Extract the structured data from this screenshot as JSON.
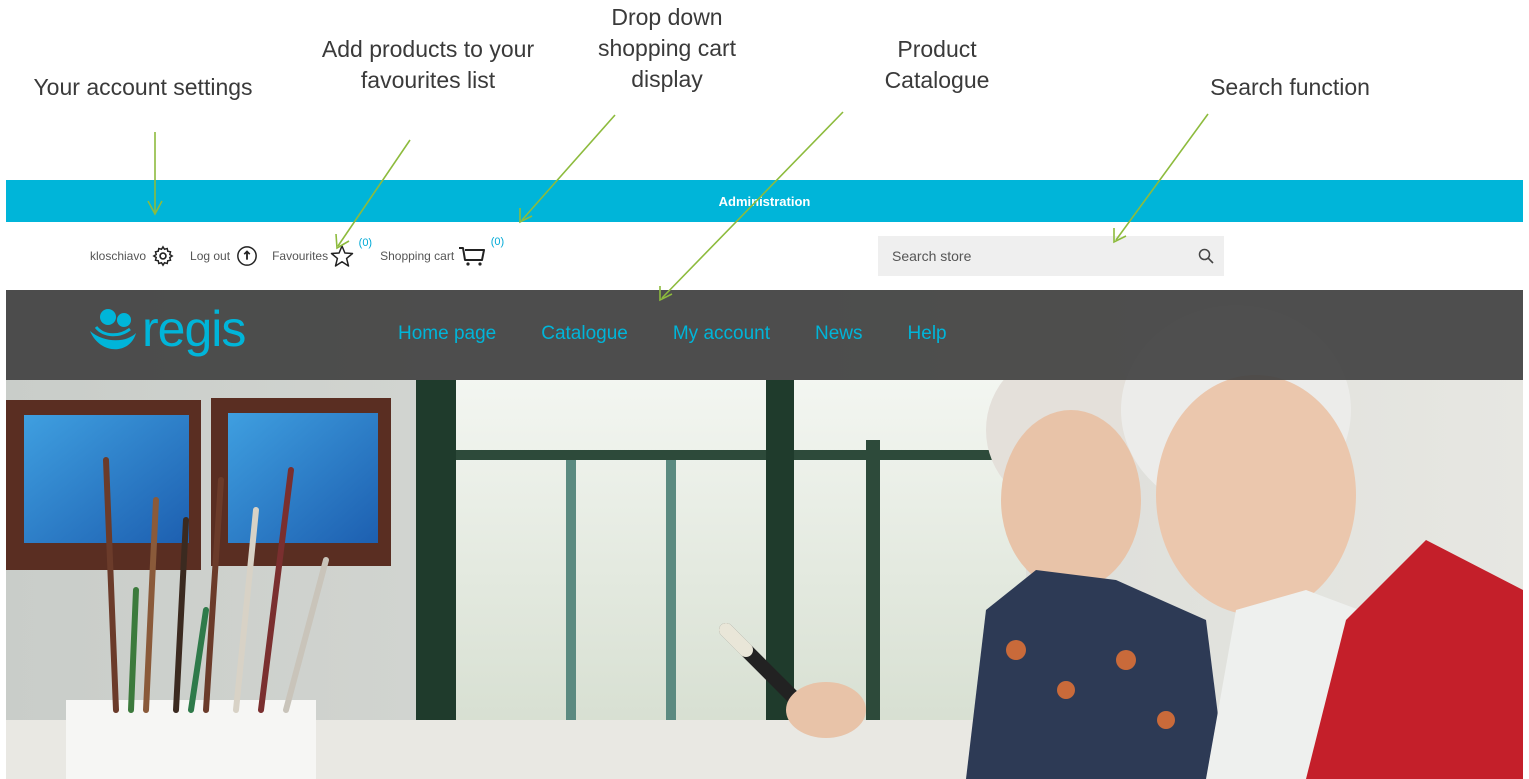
{
  "annotations": {
    "account": "Your account settings",
    "favourites": "Add products to your favourites list",
    "cart": "Drop down shopping cart display",
    "catalogue": "Product Catalogue",
    "search": "Search function",
    "arrow_color": "#8dbb3d"
  },
  "admin_bar": {
    "label": "Administration",
    "color": "#00b5d9"
  },
  "utility": {
    "username": "kloschiavo",
    "settings_icon": "gear-icon",
    "logout_label": "Log out",
    "logout_icon": "logout-icon",
    "favourites_label": "Favourites",
    "favourites_icon": "star-icon",
    "favourites_count": "(0)",
    "cart_label": "Shopping cart",
    "cart_icon": "cart-icon",
    "cart_count": "(0)"
  },
  "search": {
    "placeholder": "Search store",
    "icon": "search-icon"
  },
  "logo": {
    "text": "regis"
  },
  "nav": {
    "home": "Home page",
    "catalogue": "Catalogue",
    "account": "My account",
    "news": "News",
    "help": "Help"
  }
}
